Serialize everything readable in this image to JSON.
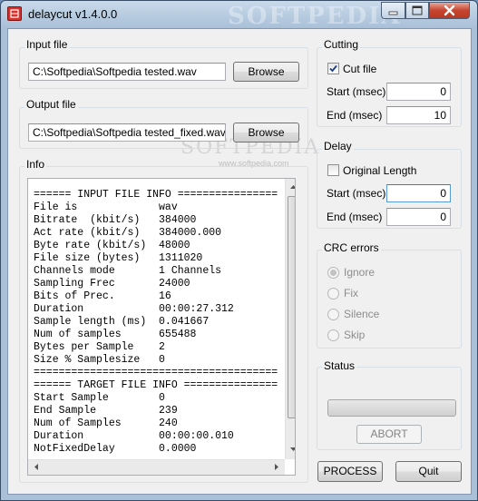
{
  "window": {
    "title": "delaycut v1.4.0.0",
    "watermark": "SOFTPEDIA",
    "watermark_small": "www.softpedia.com"
  },
  "input_file": {
    "group_label": "Input file",
    "path": "C:\\Softpedia\\Softpedia tested.wav",
    "browse_label": "Browse"
  },
  "output_file": {
    "group_label": "Output file",
    "path": "C:\\Softpedia\\Softpedia tested_fixed.wav",
    "browse_label": "Browse"
  },
  "info": {
    "group_label": "Info",
    "text": "====== INPUT FILE INFO ================\nFile is             wav\nBitrate  (kbit/s)   384000\nAct rate (kbit/s)   384000.000\nByte rate (kbit/s)  48000\nFile size (bytes)   1311020\nChannels mode       1 Channels\nSampling Frec       24000\nBits of Prec.       16\nDuration            00:00:27.312\nSample length (ms)  0.041667\nNum of samples      655488\nBytes per Sample    2\nSize % Samplesize   0\n=======================================\n====== TARGET FILE INFO ===============\nStart Sample        0\nEnd Sample          239\nNum of Samples      240\nDuration            00:00:00.010\nNotFixedDelay       0.0000"
  },
  "cutting": {
    "group_label": "Cutting",
    "cut_file_label": "Cut file",
    "cut_file_checked": true,
    "start_label": "Start (msec)",
    "start_value": "0",
    "end_label": "End (msec)",
    "end_value": "10"
  },
  "delay": {
    "group_label": "Delay",
    "original_length_label": "Original Length",
    "original_length_checked": false,
    "start_label": "Start (msec)",
    "start_value": "0",
    "end_label": "End (msec)",
    "end_value": "0"
  },
  "crc_errors": {
    "group_label": "CRC errors",
    "options": [
      "Ignore",
      "Fix",
      "Silence",
      "Skip"
    ],
    "selected": "Ignore"
  },
  "status": {
    "group_label": "Status",
    "progress": 0,
    "abort_label": "ABORT"
  },
  "actions": {
    "process_label": "PROCESS",
    "quit_label": "Quit"
  }
}
